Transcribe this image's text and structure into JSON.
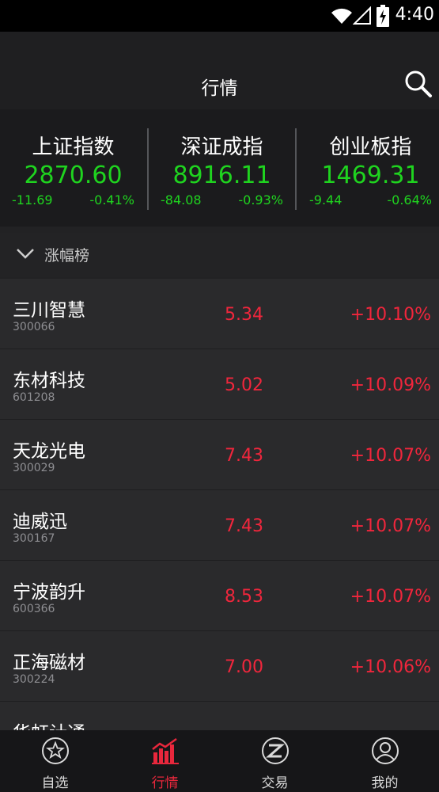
{
  "status": {
    "time": "4:40"
  },
  "nav": {
    "title": "行情"
  },
  "indices": [
    {
      "name": "上证指数",
      "value": "2870.60",
      "change": "-11.69",
      "percent": "-0.41%"
    },
    {
      "name": "深证成指",
      "value": "8916.11",
      "change": "-84.08",
      "percent": "-0.93%"
    },
    {
      "name": "创业板指",
      "value": "1469.31",
      "change": "-9.44",
      "percent": "-0.64%"
    }
  ],
  "section": {
    "title": "涨幅榜"
  },
  "stocks": [
    {
      "name": "三川智慧",
      "code": "300066",
      "price": "5.34",
      "percent": "+10.10%"
    },
    {
      "name": "东材科技",
      "code": "601208",
      "price": "5.02",
      "percent": "+10.09%"
    },
    {
      "name": "天龙光电",
      "code": "300029",
      "price": "7.43",
      "percent": "+10.07%"
    },
    {
      "name": "迪威迅",
      "code": "300167",
      "price": "7.43",
      "percent": "+10.07%"
    },
    {
      "name": "宁波韵升",
      "code": "600366",
      "price": "8.53",
      "percent": "+10.07%"
    },
    {
      "name": "正海磁材",
      "code": "300224",
      "price": "7.00",
      "percent": "+10.06%"
    },
    {
      "name": "华虹计通",
      "code": "",
      "price": "",
      "percent": ""
    }
  ],
  "tabs": [
    {
      "label": "自选",
      "icon": "star-icon"
    },
    {
      "label": "行情",
      "icon": "chart-icon"
    },
    {
      "label": "交易",
      "icon": "trade-icon"
    },
    {
      "label": "我的",
      "icon": "user-icon"
    }
  ],
  "colors": {
    "up": "#f0263c",
    "down": "#1fd41f",
    "active_tab": "#e8273c",
    "background": "#222224"
  }
}
